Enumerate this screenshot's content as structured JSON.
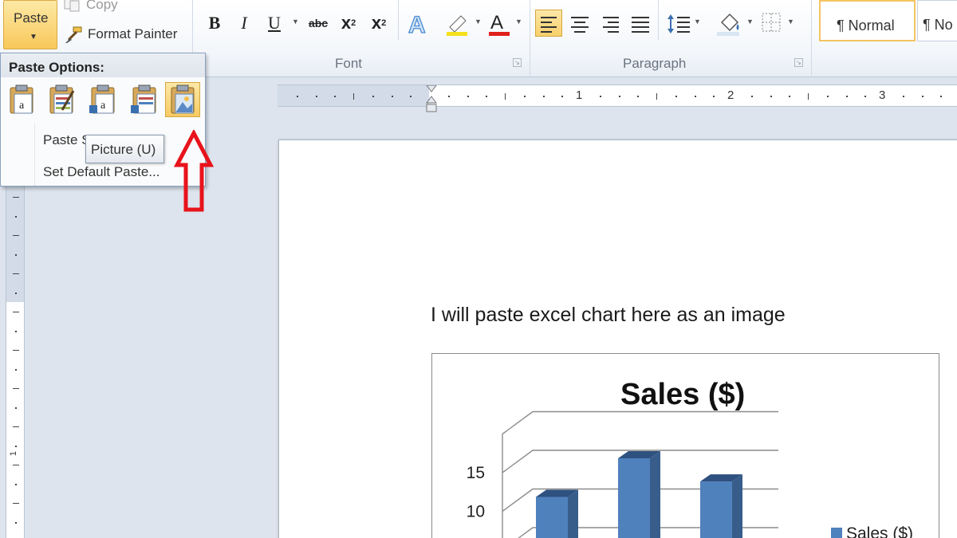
{
  "clipboard": {
    "paste_label": "Paste",
    "copy_label": "Copy",
    "format_painter_label": "Format Painter"
  },
  "font_group": {
    "label": "Font",
    "bold": "B",
    "italic": "I",
    "underline": "U",
    "strikethrough": "abc",
    "subscript": "x",
    "superscript": "x"
  },
  "paragraph_group": {
    "label": "Paragraph"
  },
  "styles": {
    "normal": "¶ Normal",
    "no_spacing": "¶ No"
  },
  "paste_menu": {
    "title": "Paste Options:",
    "paste_special": "Paste S",
    "set_default": "Set Default Paste...",
    "tooltip": "Picture (U)"
  },
  "ruler": {
    "numbers": [
      "1",
      "2",
      "3"
    ],
    "vertical_number": "1"
  },
  "document": {
    "text": "I will paste excel chart here as an image"
  },
  "colors": {
    "highlight": "#f4e01b",
    "font_color": "#e0201b",
    "bar": "#4f81bd",
    "arrow": "#e8131b"
  },
  "chart_data": {
    "type": "bar",
    "title": "Sales ($)",
    "categories": [
      "",
      "",
      ""
    ],
    "series": [
      {
        "name": "Sales ($)",
        "values": [
          10,
          15,
          12
        ]
      }
    ],
    "y_ticks": [
      "10",
      "15"
    ],
    "ylim": [
      0,
      15
    ],
    "legend": "right",
    "grid": true
  }
}
